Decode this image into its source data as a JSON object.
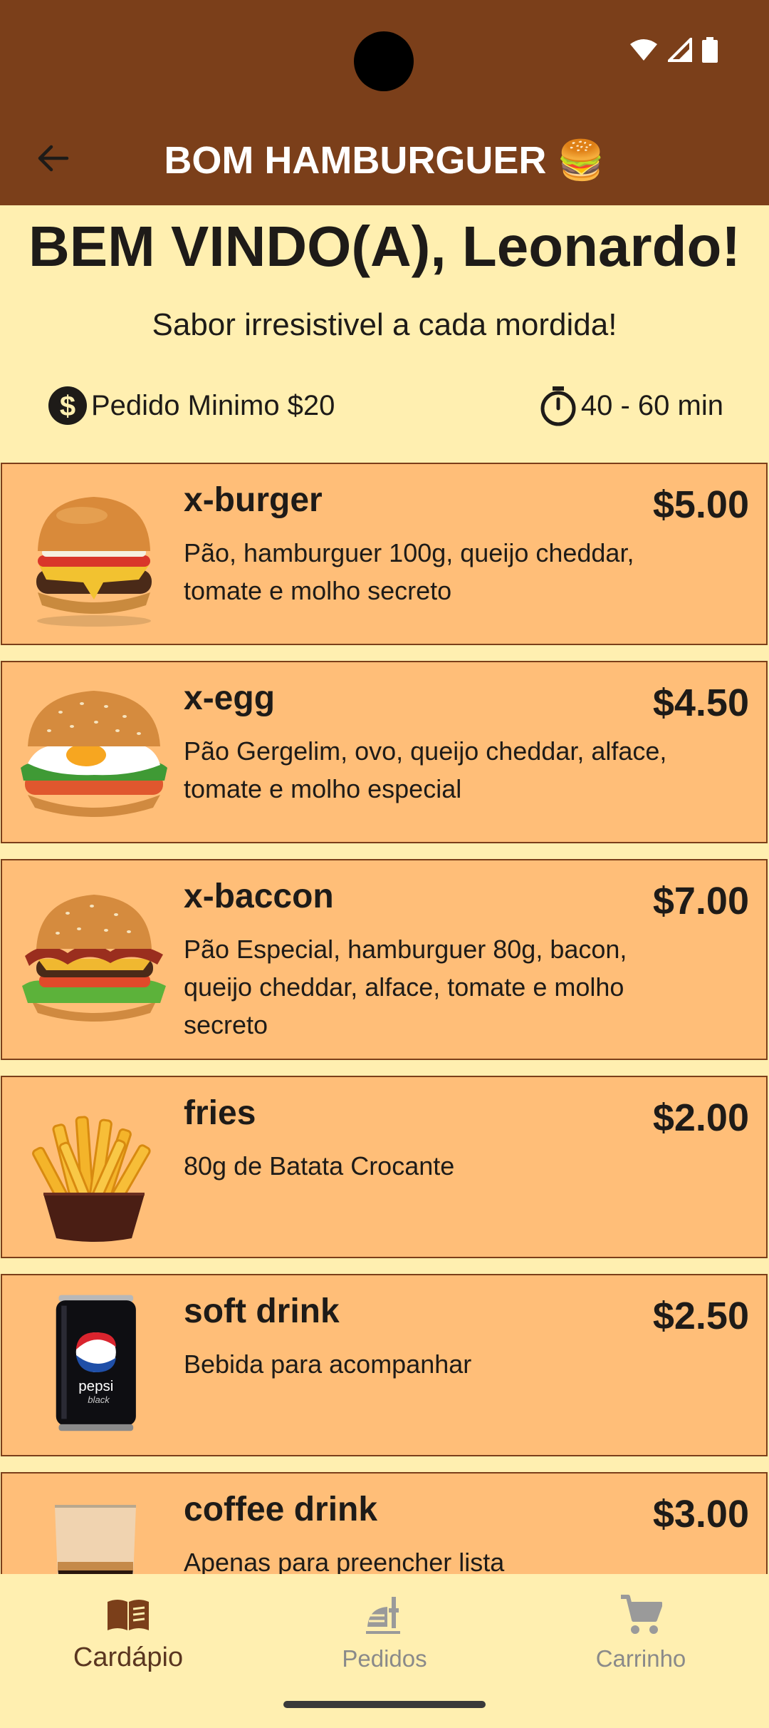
{
  "app_bar": {
    "title": "BOM HAMBURGUER 🍔",
    "back_icon": "arrow-back-icon"
  },
  "status_bar": {
    "icons": [
      "wifi-icon",
      "signal-icon",
      "battery-icon"
    ]
  },
  "header": {
    "welcome": "BEM VINDO(A), Leonardo!",
    "tagline": "Sabor irresistivel a cada mordida!",
    "min_order": "Pedido Minimo $20",
    "delivery_time": "40 - 60 min"
  },
  "menu": [
    {
      "name": "x-burger",
      "price": "$5.00",
      "description": "Pão, hamburguer 100g, queijo cheddar, tomate e molho secreto",
      "image": "burger-image"
    },
    {
      "name": "x-egg",
      "price": "$4.50",
      "description": "Pão Gergelim, ovo, queijo cheddar, alface, tomate e molho especial",
      "image": "egg-burger-image"
    },
    {
      "name": "x-baccon",
      "price": "$7.00",
      "description": "Pão Especial, hamburguer 80g, bacon, queijo cheddar, alface, tomate e molho secreto",
      "image": "bacon-burger-image"
    },
    {
      "name": "fries",
      "price": "$2.00",
      "description": "80g de Batata Crocante",
      "image": "fries-image"
    },
    {
      "name": "soft drink",
      "price": "$2.50",
      "description": "Bebida para acompanhar",
      "image": "soda-can-image"
    },
    {
      "name": "coffee drink",
      "price": "$3.00",
      "description": "Apenas para preencher lista",
      "image": "coffee-glass-image"
    }
  ],
  "bottom_nav": {
    "items": [
      {
        "label": "Cardápio",
        "icon": "menu-book-icon",
        "active": true
      },
      {
        "label": "Pedidos",
        "icon": "orders-icon",
        "active": false
      },
      {
        "label": "Carrinho",
        "icon": "cart-icon",
        "active": false
      }
    ]
  },
  "colors": {
    "brand": "#7B3F1A",
    "background": "#FFEFB0",
    "card": "#FFBE78",
    "text": "#1E1B18"
  }
}
